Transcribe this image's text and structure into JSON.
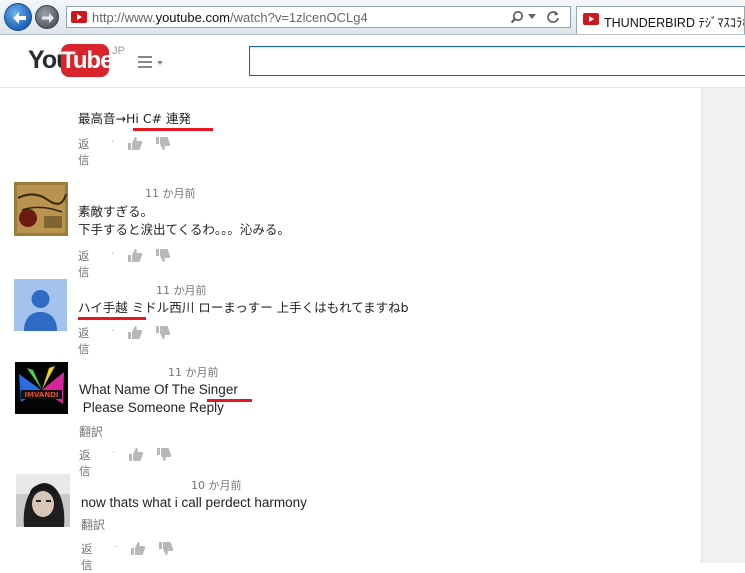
{
  "browser": {
    "url_prefix": "http://www.",
    "url_host": "youtube.com",
    "url_path": "/watch?v=1zlcenOCLg4",
    "tab_title": "THUNDERBIRD ﾃｼﾞﾏｽｺﾗﾎ..."
  },
  "header": {
    "logo_you": "You",
    "logo_tube": "Tube",
    "region": "JP",
    "search_value": ""
  },
  "comments": [
    {
      "timestamp": "",
      "lines": [
        "最高音→Hi C#  連発"
      ],
      "reply_label": "返信"
    },
    {
      "timestamp": "11 か月前",
      "lines": [
        "素敵すぎる。",
        "下手すると涙出てくるわ。。。沁みる。"
      ],
      "reply_label": "返信"
    },
    {
      "timestamp": "11 か月前",
      "lines": [
        "ハイ手越 ミドル西川 ローまっすー 上手くはもれてますねb"
      ],
      "reply_label": "返信"
    },
    {
      "timestamp": "11 か月前",
      "lines": [
        "What Name Of The Singer",
        " Please Someone Reply"
      ],
      "translate": "翻訳",
      "reply_label": "返信"
    },
    {
      "timestamp": "10 か月前",
      "lines": [
        "now thats what i call perdect harmony"
      ],
      "translate": "翻訳",
      "reply_label": "返信"
    }
  ],
  "colors": {
    "brand_red": "#d8242a",
    "annotation_red": "#e8161e",
    "search_border": "#1c62b9",
    "meta_gray": "#767676"
  },
  "icons": [
    "back-arrow-icon",
    "forward-arrow-icon",
    "youtube-favicon-icon",
    "search-icon",
    "refresh-icon",
    "guide-menu-icon",
    "thumbs-up-icon",
    "thumbs-down-icon"
  ]
}
